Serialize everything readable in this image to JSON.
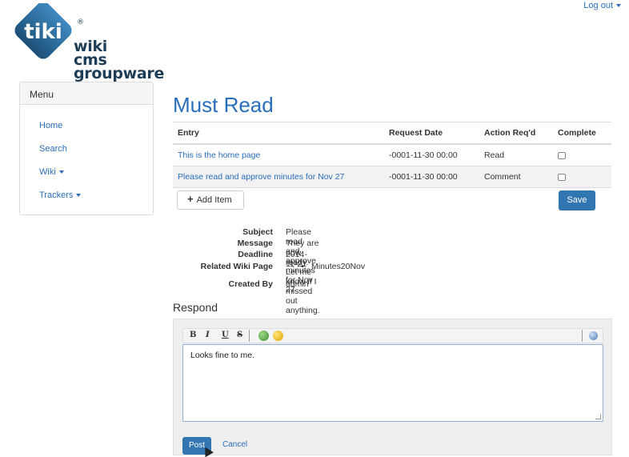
{
  "header": {
    "logout_label": "Log out"
  },
  "logo": {
    "badge": "tiki",
    "reg": "®",
    "lines": [
      "wiki",
      "cms",
      "groupware"
    ]
  },
  "menu": {
    "title": "Menu",
    "items": [
      {
        "label": "Home",
        "has_caret": false
      },
      {
        "label": "Search",
        "has_caret": false
      },
      {
        "label": "Wiki",
        "has_caret": true
      },
      {
        "label": "Trackers",
        "has_caret": true
      }
    ]
  },
  "page": {
    "title": "Must Read"
  },
  "table": {
    "headers": [
      "Entry",
      "Request Date",
      "Action Req'd",
      "Complete"
    ],
    "rows": [
      {
        "entry": "This is the home page",
        "request_date": "-0001-11-30 00:00",
        "action": "Read",
        "complete": false
      },
      {
        "entry": "Please read and approve minutes for Nov 27",
        "request_date": "-0001-11-30 00:00",
        "action": "Comment",
        "complete": false
      }
    ]
  },
  "actions": {
    "add_item_label": "Add Item",
    "save_label": "Save"
  },
  "details": {
    "subject_label": "Subject",
    "subject": "Please read and approve minutes for Nov 27",
    "message_label": "Message",
    "message": "They are now ready. Let me know if I missed out anything.",
    "deadline_label": "Deadline",
    "deadline": "2014-11-21",
    "related_label": "Related Wiki Page",
    "related": "Minutes20Nov",
    "created_label": "Created By",
    "created": "admin"
  },
  "respond": {
    "heading": "Respond",
    "toolbar": [
      "B",
      "I",
      "U",
      "S"
    ],
    "text": "Looks fine to me.",
    "post_label": "Post",
    "cancel_label": "Cancel"
  },
  "colors": {
    "accent": "#2a6ebb",
    "primary_button": "#3276b1",
    "logo_badge": "#2b6c9c"
  }
}
